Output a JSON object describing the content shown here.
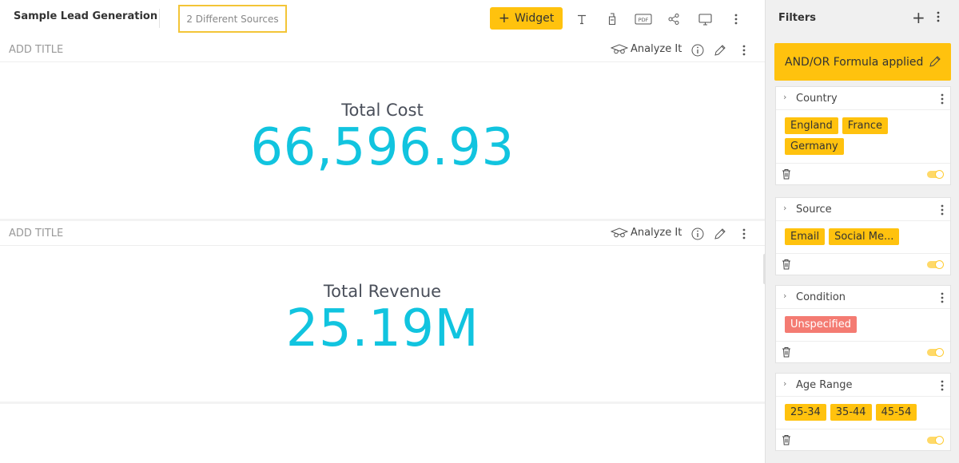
{
  "header": {
    "title": "Sample Lead Generation",
    "sources_label": "2 Different Sources",
    "widget_button": {
      "icon": "+",
      "label": "Widget"
    },
    "toolbar_icons": [
      "text-icon",
      "paint-bucket-icon",
      "pdf-icon",
      "share-icon",
      "presentation-icon",
      "more-vertical-icon"
    ],
    "pdf_badge": "PDF"
  },
  "widgets": [
    {
      "title_placeholder": "ADD TITLE",
      "analyze_label": "Analyze It",
      "metric_label": "Total Cost",
      "metric_value": "66,596.93"
    },
    {
      "title_placeholder": "ADD TITLE",
      "analyze_label": "Analyze It",
      "metric_label": "Total Revenue",
      "metric_value": "25.19M"
    }
  ],
  "filters": {
    "title": "Filters",
    "add_icon": "+",
    "formula_label": "AND/OR Formula applied",
    "cards": [
      {
        "name": "Country",
        "chips": [
          "England",
          "France",
          "Germany"
        ],
        "status": "active"
      },
      {
        "name": "Source",
        "chips": [
          "Email",
          "Social Me..."
        ],
        "status": "active"
      },
      {
        "name": "Condition",
        "chips": [
          "Unspecified"
        ],
        "status": "unspecified"
      },
      {
        "name": "Age Range",
        "chips": [
          "25-34",
          "35-44",
          "45-54"
        ],
        "status": "active"
      }
    ]
  },
  "colors": {
    "accent": "#ffc20e",
    "kpi": "#11c4df",
    "unspecified": "#f47b72"
  }
}
